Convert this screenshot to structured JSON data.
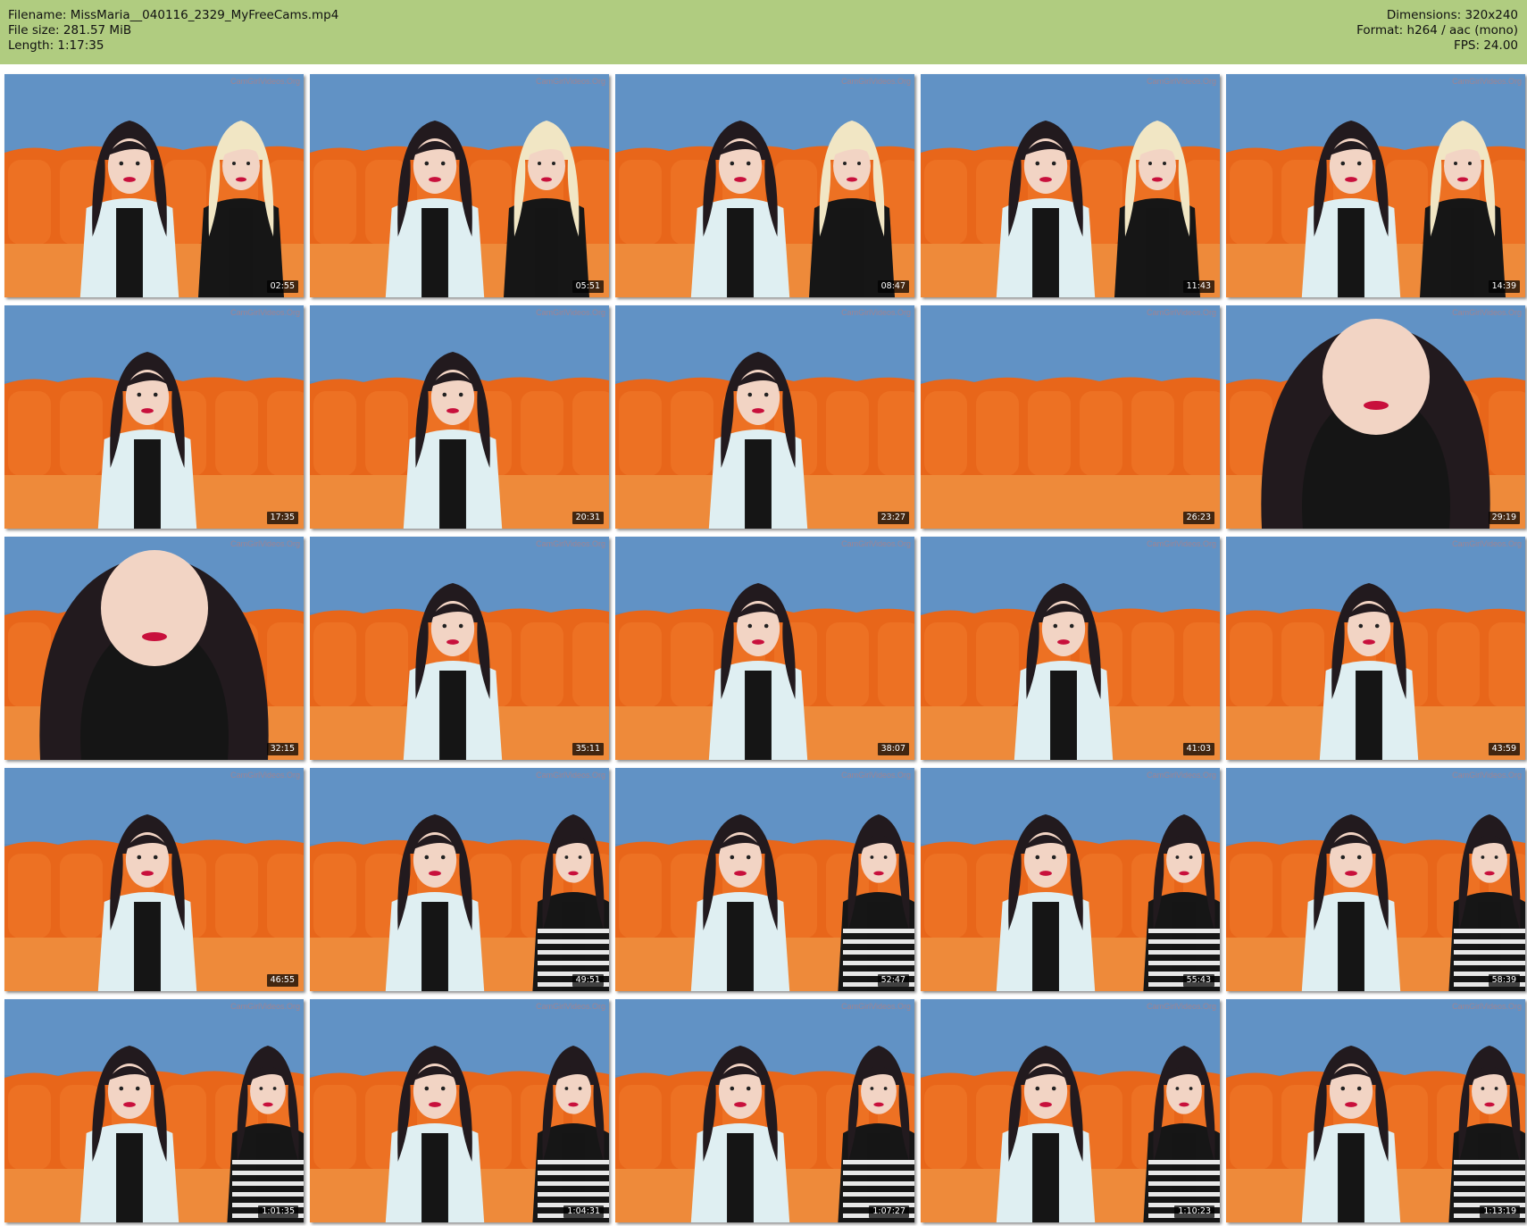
{
  "info": {
    "filename_label": "Filename: MissMaria__040116_2329_MyFreeCams.mp4",
    "filesize_label": "File size: 281.57 MiB",
    "length_label": "Length: 1:17:35",
    "dimensions_label": "Dimensions: 320x240",
    "format_label": "Format: h264 / aac (mono)",
    "fps_label": "FPS: 24.00"
  },
  "watermark": "CamGirlVideos.Org",
  "thumbnails": [
    {
      "time": "02:55",
      "scene": "two-women",
      "companion": "blonde"
    },
    {
      "time": "05:51",
      "scene": "two-women",
      "companion": "blonde"
    },
    {
      "time": "08:47",
      "scene": "two-women",
      "companion": "blonde"
    },
    {
      "time": "11:43",
      "scene": "two-women",
      "companion": "blonde"
    },
    {
      "time": "14:39",
      "scene": "two-women",
      "companion": "blonde"
    },
    {
      "time": "17:35",
      "scene": "one-woman",
      "companion": "none"
    },
    {
      "time": "20:31",
      "scene": "one-woman",
      "companion": "none"
    },
    {
      "time": "23:27",
      "scene": "one-woman",
      "companion": "none"
    },
    {
      "time": "26:23",
      "scene": "empty-sofa",
      "companion": "none"
    },
    {
      "time": "29:19",
      "scene": "close-up",
      "companion": "none"
    },
    {
      "time": "32:15",
      "scene": "close-up",
      "companion": "none"
    },
    {
      "time": "35:11",
      "scene": "one-woman",
      "companion": "none"
    },
    {
      "time": "38:07",
      "scene": "one-woman",
      "companion": "none"
    },
    {
      "time": "41:03",
      "scene": "one-woman",
      "companion": "none"
    },
    {
      "time": "43:59",
      "scene": "one-woman",
      "companion": "none"
    },
    {
      "time": "46:55",
      "scene": "one-woman",
      "companion": "none"
    },
    {
      "time": "49:51",
      "scene": "two-women",
      "companion": "brunette"
    },
    {
      "time": "52:47",
      "scene": "two-women",
      "companion": "brunette"
    },
    {
      "time": "55:43",
      "scene": "two-women",
      "companion": "brunette"
    },
    {
      "time": "58:39",
      "scene": "two-women",
      "companion": "brunette"
    },
    {
      "time": "1:01:35",
      "scene": "two-women",
      "companion": "brunette"
    },
    {
      "time": "1:04:31",
      "scene": "two-women",
      "companion": "brunette"
    },
    {
      "time": "1:07:27",
      "scene": "two-women",
      "companion": "brunette"
    },
    {
      "time": "1:10:23",
      "scene": "two-women",
      "companion": "brunette"
    },
    {
      "time": "1:13:19",
      "scene": "two-women",
      "companion": "brunette"
    }
  ],
  "colors": {
    "header_bg": "#b0cc80",
    "wall": "#5a8cc0",
    "sofa": "#e8661a",
    "cardigan": "#dfeff2",
    "dark_hair": "#221a1e",
    "blonde_hair": "#f1e6c4"
  }
}
